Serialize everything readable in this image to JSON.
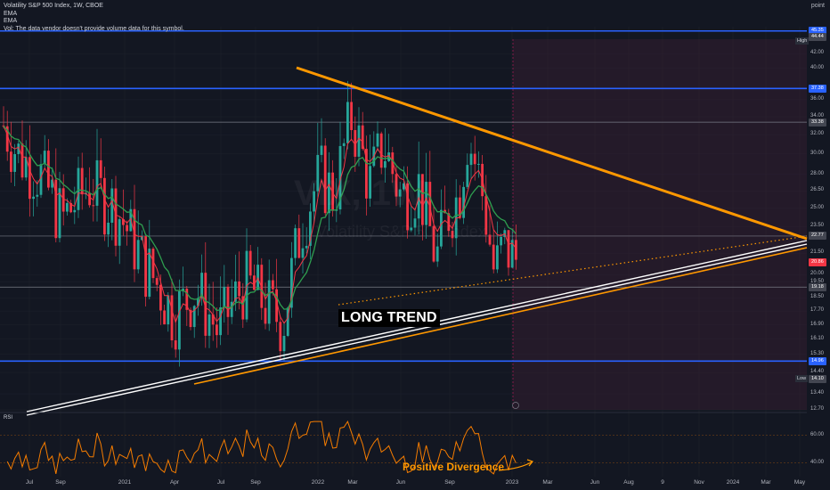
{
  "legend": {
    "symbol_line": "Volatility S&P 500 Index, 1W, CBOE",
    "ema1": "EMA",
    "ema2": "EMA",
    "vol_note": "Vol: The data vendor doesn't provide volume data for this symbol."
  },
  "axis_title": "point",
  "watermark": {
    "ticker": "VIX, 1W",
    "name": "Volatility S&P 500 Index"
  },
  "rsi_label": "RSI",
  "annotations": {
    "long_trend": "LONG TREND",
    "positive_divergence": "Positive Divergence"
  },
  "side_labels": {
    "high": "High",
    "low": "Low"
  },
  "colors": {
    "background": "#131722",
    "up": "#26a69a",
    "down": "#f23645",
    "ema_fast": "#f23645",
    "ema_slow": "#2e9e4f",
    "blue_levels": "#2962ff",
    "trendline_orange": "#ff9800",
    "trendline_white": "#ffffff",
    "rsi_line": "#f57c00",
    "projection_zone": "#3a2033"
  },
  "chart_data": [
    {
      "type": "candlestick",
      "interval": "1W",
      "ylim": [
        12.7,
        46
      ],
      "scale": "log",
      "ytick_labels": [
        "42.00",
        "40.00",
        "36.00",
        "34.00",
        "32.00",
        "30.00",
        "28.00",
        "26.50",
        "25.00",
        "23.50",
        "21.50",
        "20.00",
        "19.50",
        "18.50",
        "17.70",
        "16.90",
        "16.10",
        "15.30",
        "14.40",
        "13.40",
        "12.70"
      ],
      "xtick_labels": [
        "Jul",
        "Sep",
        "2021",
        "Apr",
        "Jul",
        "Sep",
        "2022",
        "Mar",
        "Jun",
        "Sep",
        "2023",
        "Mar",
        "Jun",
        "Aug",
        "9",
        "Nov",
        "2024",
        "Mar",
        "May"
      ],
      "price_badges": [
        {
          "label": "45.35",
          "value": 45.35,
          "color": "#2962ff"
        },
        {
          "label": "44.44",
          "value": 44.44,
          "color": "#434651"
        },
        {
          "label": "37.38",
          "value": 37.38,
          "color": "#2962ff"
        },
        {
          "label": "33.38",
          "value": 33.38,
          "color": "#434651"
        },
        {
          "label": "22.77",
          "value": 22.77,
          "color": "#434651"
        },
        {
          "label": "20.86",
          "value": 20.86,
          "color": "#f23645"
        },
        {
          "label": "19.18",
          "value": 19.18,
          "color": "#434651"
        },
        {
          "label": "14.96",
          "value": 14.96,
          "color": "#2962ff"
        },
        {
          "label": "14.10",
          "value": 14.1,
          "color": "#434651"
        }
      ],
      "horizontal_levels": [
        {
          "value": 45.35,
          "color": "#2962ff"
        },
        {
          "value": 37.38,
          "color": "#2962ff"
        },
        {
          "value": 33.38,
          "color": "#787b86"
        },
        {
          "value": 22.77,
          "color": "#787b86"
        },
        {
          "value": 19.18,
          "color": "#787b86"
        },
        {
          "value": 14.96,
          "color": "#2962ff"
        }
      ],
      "side_label_values": {
        "high": 44.44,
        "low": 14.1
      }
    },
    {
      "type": "line",
      "title": "RSI",
      "ylim": [
        30,
        72
      ],
      "ytick_labels": [
        "60.00",
        "40.00"
      ],
      "levels": [
        60,
        40
      ]
    }
  ]
}
